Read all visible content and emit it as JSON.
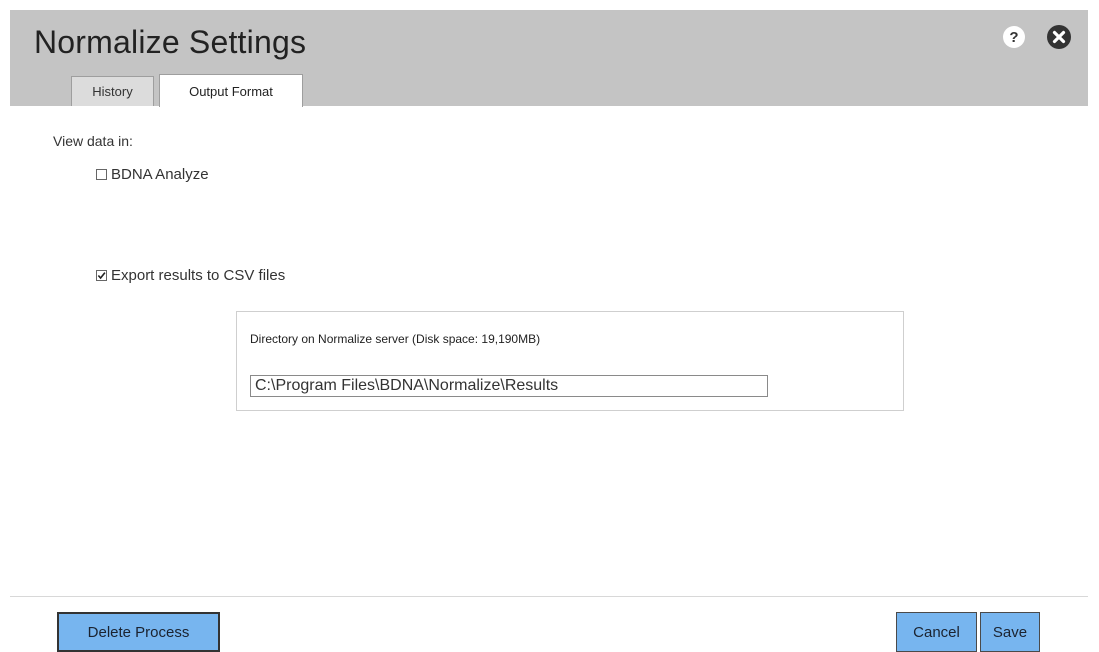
{
  "dialog": {
    "title": "Normalize Settings",
    "icons": {
      "help": "help-icon",
      "close": "close-icon"
    }
  },
  "tabs": [
    {
      "label": "History",
      "active": false
    },
    {
      "label": "Output Format",
      "active": true
    }
  ],
  "content": {
    "view_label": "View data in:",
    "bdna_analyze": {
      "label": "BDNA Analyze",
      "checked": false
    },
    "export_csv": {
      "label": "Export results to CSV files",
      "checked": true
    },
    "directory": {
      "label": "Directory on Normalize server (Disk space: 19,190MB)",
      "value": "C:\\Program Files\\BDNA\\Normalize\\Results"
    }
  },
  "footer": {
    "delete_label": "Delete Process",
    "cancel_label": "Cancel",
    "save_label": "Save"
  },
  "colors": {
    "header_bg": "#c4c4c4",
    "button_bg": "#77b5ef",
    "icon_dark": "#333333"
  }
}
